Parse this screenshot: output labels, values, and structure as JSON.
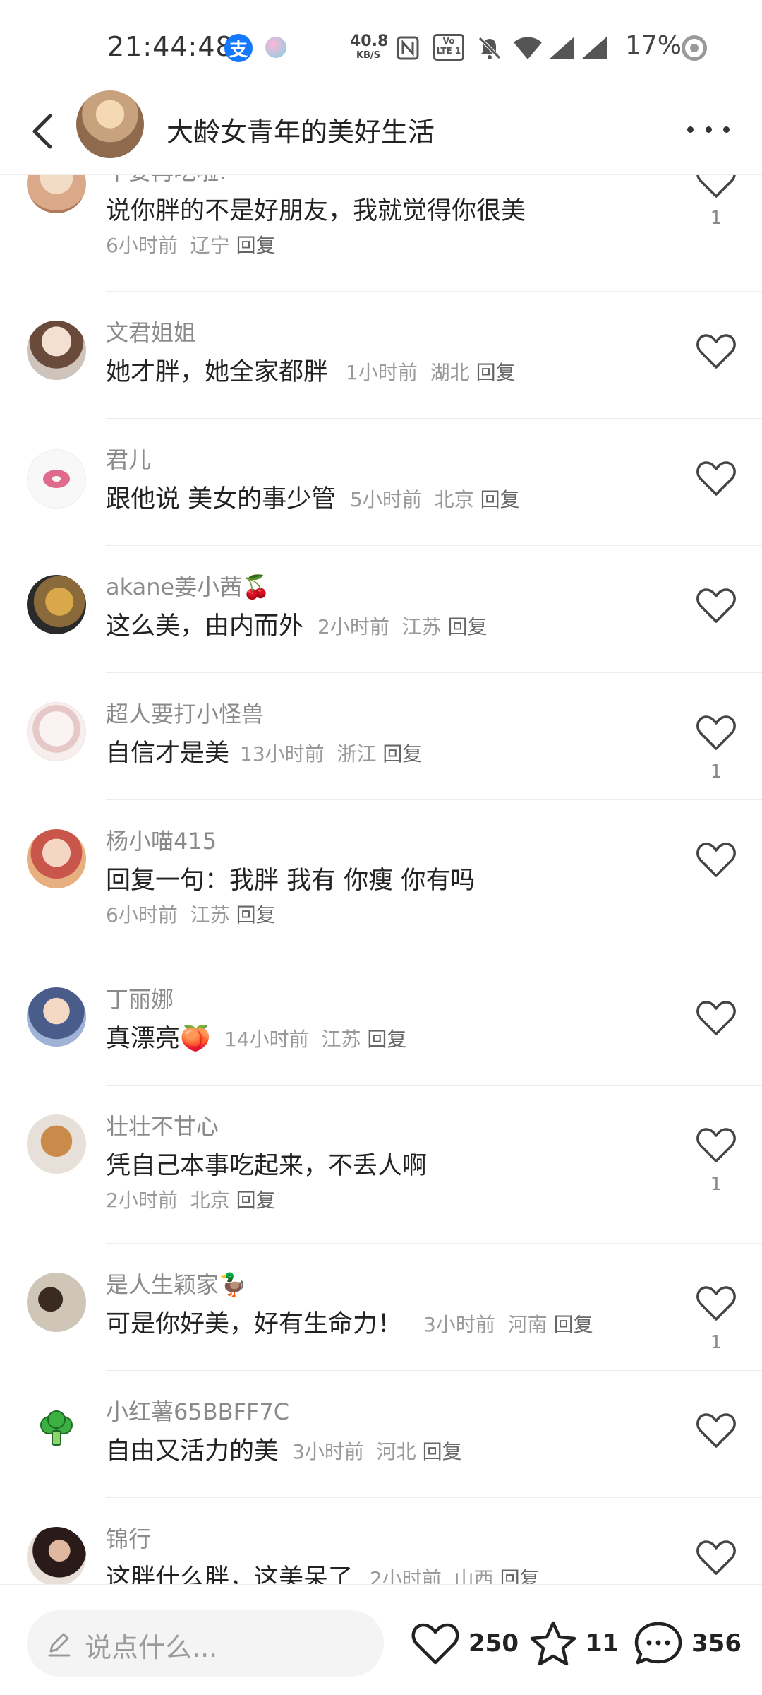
{
  "status_bar": {
    "time": "21:44:48",
    "alipay_glyph": "支",
    "net_speed_value": "40.8",
    "net_speed_unit": "KB/S",
    "volte_label": "Vo LTE 1",
    "battery": "17%"
  },
  "header": {
    "title": "大龄女青年的美好生活"
  },
  "comments": [
    {
      "name": "不要再吃啦!",
      "text": "说你胖的不是好朋友，我就觉得你很美",
      "time": "6小时前",
      "location": "辽宁",
      "reply": "回复",
      "likes": "1",
      "avatar_color": "#e8c7a8"
    },
    {
      "name": "文君姐姐",
      "text": "她才胖，她全家都胖",
      "time": "1小时前",
      "location": "湖北",
      "reply": "回复",
      "likes": "",
      "avatar_color": "#d9b89a"
    },
    {
      "name": "君儿",
      "text": "跟他说 美女的事少管",
      "time": "5小时前",
      "location": "北京",
      "reply": "回复",
      "likes": "",
      "avatar_color": "#f7f7f7"
    },
    {
      "name": "akane姜小茜",
      "name_emoji": "🍒",
      "text": "这么美，由内而外",
      "time": "2小时前",
      "location": "江苏",
      "reply": "回复",
      "likes": "",
      "avatar_color": "#8a6a3a"
    },
    {
      "name": "超人要打小怪兽",
      "text": "自信才是美",
      "time": "13小时前",
      "location": "浙江",
      "reply": "回复",
      "likes": "1",
      "avatar_color": "#f3e4e4"
    },
    {
      "name": "杨小喵415",
      "text": "回复一句：我胖 我有 你瘦 你有吗",
      "time": "6小时前",
      "location": "江苏",
      "reply": "回复",
      "likes": "",
      "avatar_color": "#d47a6a"
    },
    {
      "name": "丁丽娜",
      "text": "真漂亮",
      "text_emoji": "🍑",
      "time": "14小时前",
      "location": "江苏",
      "reply": "回复",
      "likes": "",
      "avatar_color": "#6b88b8"
    },
    {
      "name": "壮壮不甘心",
      "text": "凭自己本事吃起来，不丢人啊",
      "time": "2小时前",
      "location": "北京",
      "reply": "回复",
      "likes": "1",
      "avatar_color": "#c7a07a"
    },
    {
      "name": "是人生颖家",
      "name_emoji": "🦆",
      "text": "可是你好美，好有生命力！",
      "time": "3小时前",
      "location": "河南",
      "reply": "回复",
      "likes": "1",
      "avatar_color": "#b8b0a0"
    },
    {
      "name": "小红薯65BBFF7C",
      "text": "自由又活力的美",
      "time": "3小时前",
      "location": "河北",
      "reply": "回复",
      "likes": "",
      "avatar_color": "#ffffff"
    },
    {
      "name": "锦行",
      "text": "这胖什么胖，这美呆了",
      "time": "2小时前",
      "location": "山西",
      "reply": "回复",
      "likes": "",
      "avatar_color": "#3a2a2a"
    }
  ],
  "bottom_bar": {
    "input_placeholder": "说点什么...",
    "likes_count": "250",
    "favorites_count": "11",
    "comments_count": "356"
  }
}
